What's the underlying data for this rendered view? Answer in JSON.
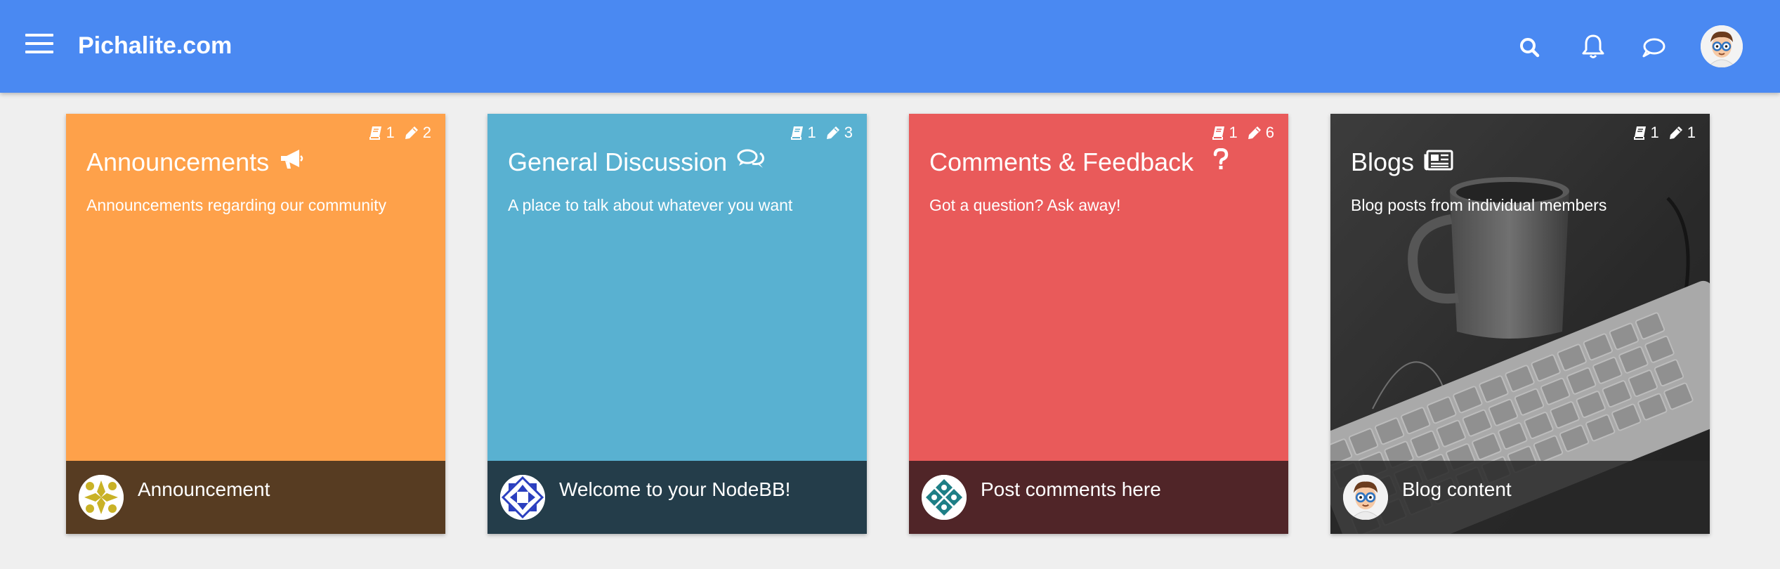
{
  "header": {
    "site_title": "Pichalite.com",
    "color": "#4a89f2",
    "icons": [
      "menu-icon",
      "search-icon",
      "bell-icon",
      "chat-icon",
      "user-avatar"
    ]
  },
  "categories": [
    {
      "title": "Announcements",
      "icon": "megaphone-icon",
      "description": "Announcements regarding our community",
      "topics": "1",
      "posts": "2",
      "color": "#fea14a",
      "footer_color": "#573c22",
      "latest_post": "Announcement"
    },
    {
      "title": "General Discussion",
      "icon": "comments-icon",
      "description": "A place to talk about whatever you want",
      "topics": "1",
      "posts": "3",
      "color": "#59b1d1",
      "footer_color": "#243d4a",
      "latest_post": "Welcome to your NodeBB!"
    },
    {
      "title": "Comments & Feedback",
      "icon": "question-icon",
      "description": "Got a question? Ask away!",
      "topics": "1",
      "posts": "6",
      "color": "#e95a5a",
      "footer_color": "#502528",
      "latest_post": "Post comments here"
    },
    {
      "title": "Blogs",
      "icon": "newspaper-icon",
      "description": "Blog posts from individual members",
      "topics": "1",
      "posts": "1",
      "color": "#3a3a3a",
      "footer_color": "#2a2a2a",
      "latest_post": "Blog content"
    }
  ]
}
